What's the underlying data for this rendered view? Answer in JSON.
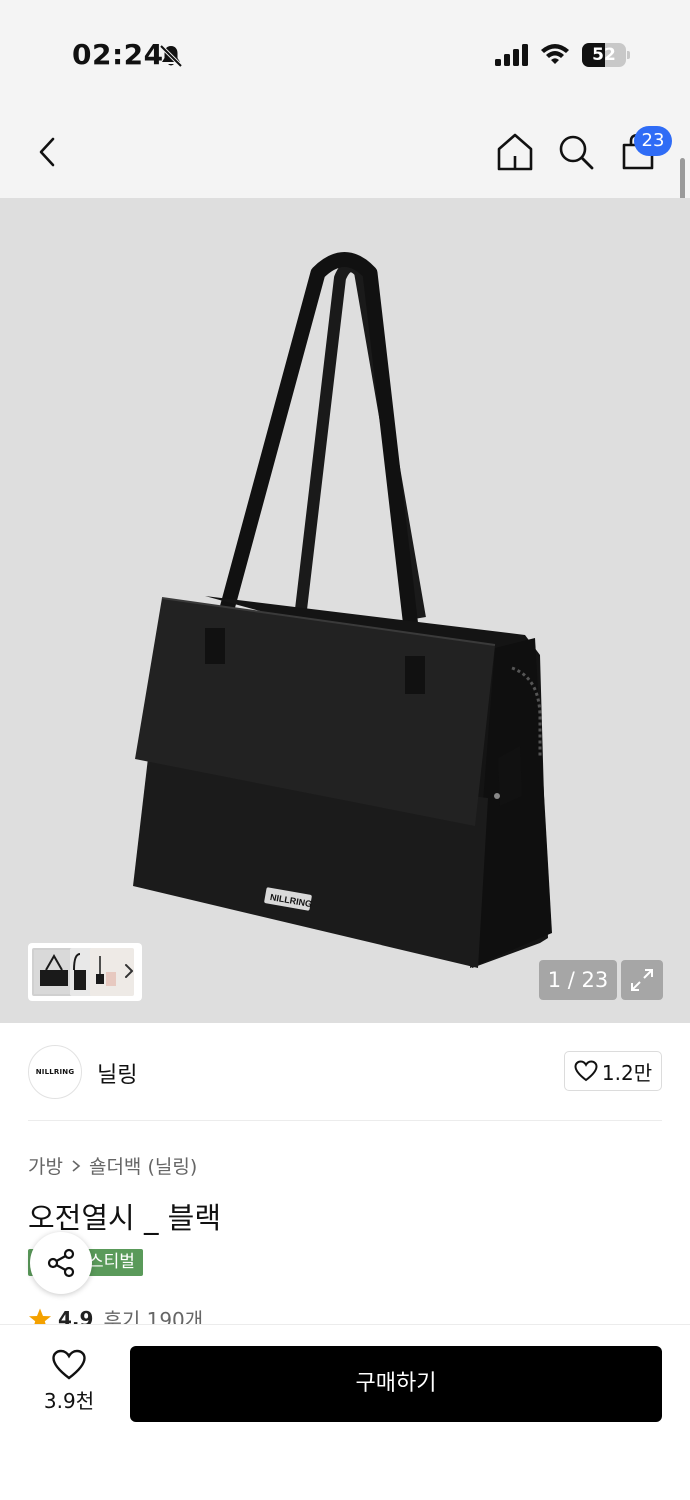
{
  "status_bar": {
    "time": "02:24",
    "battery_level": "52",
    "battery_percent": 52,
    "icons": [
      "bell-off-icon",
      "signal-icon",
      "wifi-icon",
      "battery-icon"
    ]
  },
  "header": {
    "icons": [
      "back-icon",
      "home-icon",
      "search-icon",
      "cart-icon"
    ],
    "cart_badge": "23",
    "badge_color": "#2f6cf6"
  },
  "gallery": {
    "counter": "1 / 23",
    "brand_print": "NILLRING",
    "icons": [
      "chevron-right-icon",
      "expand-icon"
    ]
  },
  "brand": {
    "logo_text": "NILLRING",
    "name": "닐링",
    "like_count": "1.2만"
  },
  "product": {
    "breadcrumb": [
      "가방",
      "숄더백 (닐링)"
    ],
    "title": "오전열시 _ 블랙",
    "badge": "스티벌",
    "badge_color": "#5a9a5a",
    "rating": "4.9",
    "reviews": "후기 190개",
    "star_color": "#f4a100"
  },
  "bottom_bar": {
    "wish_count": "3.9천",
    "buy_label": "구매하기"
  }
}
